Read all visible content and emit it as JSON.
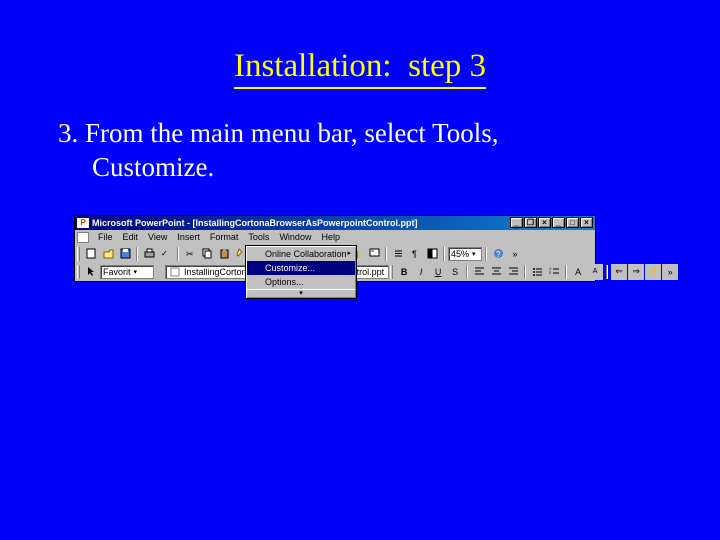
{
  "slide": {
    "title_a": "Installation:",
    "title_b": "step 3",
    "body_line1": "3. From the main menu bar, select Tools,",
    "body_line2": "Customize."
  },
  "screenshot": {
    "titlebar": {
      "app_icon_text": "P",
      "text": "Microsoft PowerPoint - [InstallingCortonaBrowserAsPowerpointControl.ppt]"
    },
    "window_buttons": {
      "min": "_",
      "max": "□",
      "close": "×",
      "child_min": "_",
      "child_max": "❐",
      "child_close": "×"
    },
    "menubar": [
      "File",
      "Edit",
      "View",
      "Insert",
      "Format",
      "Tools",
      "Window",
      "Help"
    ],
    "toolbar1": {
      "zoom_value": "45%"
    },
    "tools_menu": {
      "items": [
        {
          "label": "Online Collaboration",
          "hl": false,
          "sub": true
        },
        {
          "label": "Customize...",
          "hl": true,
          "sub": false
        },
        {
          "label": "Options...",
          "hl": false,
          "sub": false
        }
      ]
    },
    "toolbar2": {
      "font_value": "Favorit",
      "filename": "InstallingCortonaBrowserAsPowerpointControl.ppt"
    }
  }
}
